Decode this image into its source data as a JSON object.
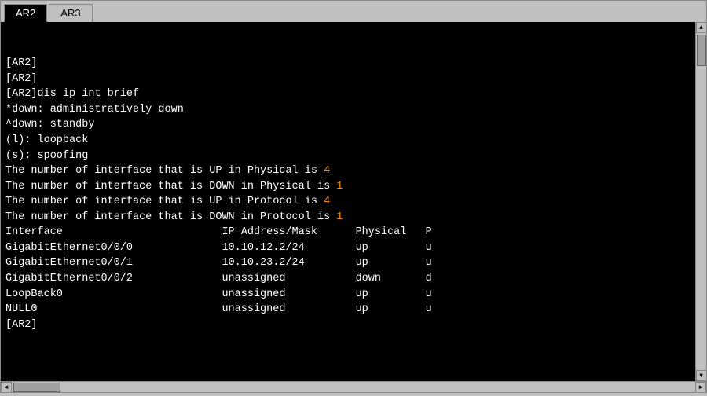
{
  "tabs": [
    {
      "label": "AR2",
      "active": true
    },
    {
      "label": "AR3",
      "active": false
    }
  ],
  "terminal": {
    "lines": [
      {
        "text": "[AR2]",
        "color": "white"
      },
      {
        "text": "[AR2]",
        "color": "white"
      },
      {
        "text": "[AR2]dis ip int brief",
        "color": "white"
      },
      {
        "text": "*down: administratively down",
        "color": "white"
      },
      {
        "text": "^down: standby",
        "color": "white"
      },
      {
        "text": "(l): loopback",
        "color": "white"
      },
      {
        "text": "(s): spoofing",
        "color": "white"
      },
      {
        "text": "The number of interface that is UP in Physical is ",
        "color": "white",
        "suffix": "4",
        "suffixColor": "orange"
      },
      {
        "text": "The number of interface that is DOWN in Physical is ",
        "color": "white",
        "suffix": "1",
        "suffixColor": "orange"
      },
      {
        "text": "The number of interface that is UP in Protocol is ",
        "color": "white",
        "suffix": "4",
        "suffixColor": "orange"
      },
      {
        "text": "The number of interface that is DOWN in Protocol is ",
        "color": "white",
        "suffix": "1",
        "suffixColor": "orange"
      },
      {
        "text": "",
        "color": "white"
      },
      {
        "text": "Interface                         IP Address/Mask      Physical   P",
        "color": "white"
      },
      {
        "text": "GigabitEthernet0/0/0              10.10.12.2/24        up         u",
        "color": "white"
      },
      {
        "text": "GigabitEthernet0/0/1              10.10.23.2/24        up         u",
        "color": "white"
      },
      {
        "text": "GigabitEthernet0/0/2              unassigned           down       d",
        "color": "white"
      },
      {
        "text": "LoopBack0                         unassigned           up         u",
        "color": "white"
      },
      {
        "text": "NULL0                             unassigned           up         u",
        "color": "white"
      },
      {
        "text": "[AR2]",
        "color": "white"
      }
    ]
  }
}
